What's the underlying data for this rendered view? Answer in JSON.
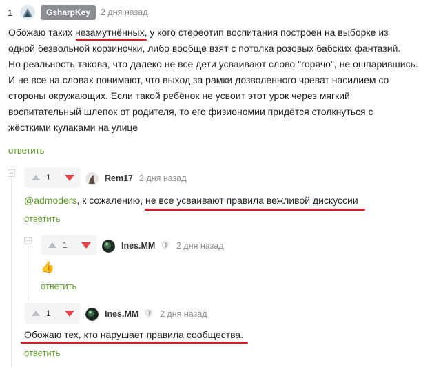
{
  "comment1": {
    "rating": "1",
    "author": "GsharpKey",
    "date": "2 дня назад",
    "lines": [
      "Обожаю таких незамутнённых, у кого стереотип воспитания построен на выборке из",
      "одной безвольной корзиночки, либо вообще взят с потолка розовых бабских фантазий.",
      "Но реальность такова, что далеко не все дети усваивают слово \"горячо\", не ошпарившись.",
      "И не все на словах понимают, что выход за рамки дозволенного чреват насилием со",
      "стороны окружающих. Если такой ребёнок не усвоит этот урок через мягкий",
      "воспитательный шлепок от родителя, то его физиономии придётся столкнуться с",
      "жёсткими кулаками на улице"
    ],
    "reply": "ответить"
  },
  "comment2": {
    "rating": "1",
    "author": "Rem17",
    "date": "2 дня назад",
    "mention": "@admoders",
    "text": ", к сожалению, не все усваивают правила вежливой дискуссии",
    "reply": "ответить"
  },
  "comment3": {
    "rating": "1",
    "author": "Ines.MM",
    "date": "2 дня назад",
    "emoji": "👍",
    "reply": "ответить"
  },
  "comment4": {
    "rating": "1",
    "author": "Ines.MM",
    "date": "2 дня назад",
    "text": "Обожаю тех, кто нарушает правила сообщества.",
    "reply": "ответить"
  },
  "colors": {
    "accent_green": "#5b9a2a",
    "downvote_red": "#e0434a",
    "highlight_red": "#d21f2b"
  }
}
